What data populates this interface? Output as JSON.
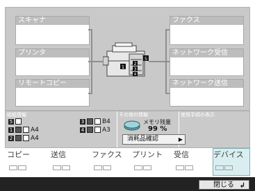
{
  "panels": {
    "scanner": "スキャナ",
    "fax": "ファクス",
    "printer": "プリンタ",
    "network_receive": "ネットワーク受信",
    "remote_copy": "リモートコピー",
    "network_send": "ネットワーク送信"
  },
  "info": {
    "paper_header": "給紙情報",
    "paper": [
      {
        "num": "",
        "size": ""
      },
      {
        "num": "3",
        "size": "B4"
      },
      {
        "num": "1",
        "size": "A4"
      },
      {
        "num": "4",
        "size": "A3"
      },
      {
        "num": "2",
        "size": "A4"
      }
    ],
    "other_header": "その他の情報",
    "memory_label": "メモリ残量",
    "memory_value": "99 %",
    "consumables_button": "消耗品確認",
    "monitor_header": "使用手順の表示"
  },
  "tabs": {
    "copy": "コピー",
    "send": "送信",
    "fax": "ファクス",
    "print": "プリント",
    "receive": "受信",
    "device": "デバイス"
  },
  "footer": {
    "close_label": "閉じる"
  },
  "colors": {
    "panel_gray": "#c9c9c9",
    "active_tab": "#d9eef0",
    "bottom_bar": "#222222"
  }
}
